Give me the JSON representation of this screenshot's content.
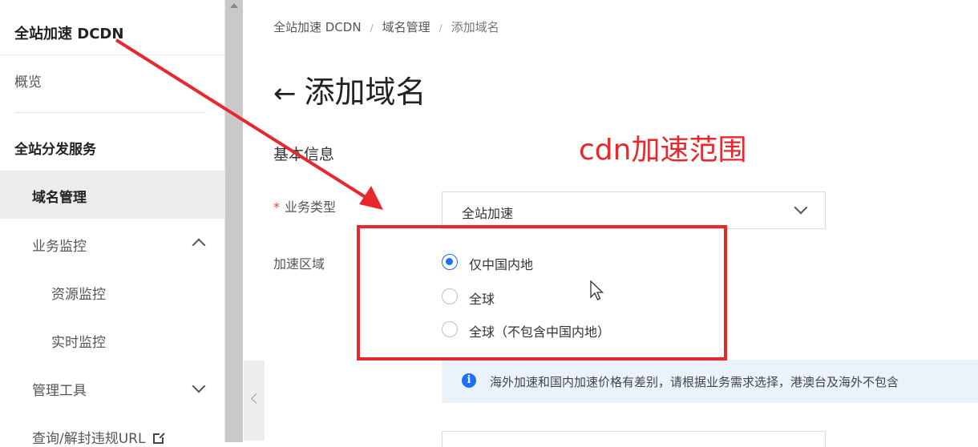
{
  "sidebar": {
    "title": "全站加速 DCDN",
    "overview": "概览",
    "section": "全站分发服务",
    "items": [
      {
        "label": "域名管理"
      },
      {
        "label": "业务监控"
      },
      {
        "label": "资源监控"
      },
      {
        "label": "实时监控"
      },
      {
        "label": "管理工具"
      },
      {
        "label": "查询/解封违规URL"
      }
    ]
  },
  "breadcrumb": [
    "全站加速 DCDN",
    "域名管理",
    "添加域名"
  ],
  "page": {
    "title": "添加域名",
    "section_title": "基本信息"
  },
  "form": {
    "business_type": {
      "required_mark": "*",
      "label": "业务类型",
      "value": "全站加速"
    },
    "accel_region": {
      "label": "加速区域",
      "options": [
        "仅中国内地",
        "全球",
        "全球（不包含中国内地）"
      ],
      "selected_index": 0
    },
    "notice": "海外加速和国内加速价格有差别，请根据业务需求选择，港澳台及海外不包含"
  },
  "annotation": {
    "text": "cdn加速范围",
    "color": "#e8282d"
  },
  "colors": {
    "accent": "#1e6ff2",
    "notice_bg": "#eaf3fc"
  }
}
